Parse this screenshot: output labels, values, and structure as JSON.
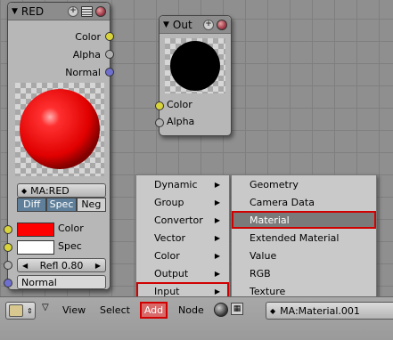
{
  "red_node": {
    "title": "RED",
    "outputs": [
      "Color",
      "Alpha",
      "Normal"
    ],
    "material": "MA:RED",
    "toggles": [
      "Diff",
      "Spec",
      "Neg"
    ],
    "inputs": {
      "color": "Color",
      "spec": "Spec",
      "refl": "Refl 0.80",
      "normal": "Normal"
    },
    "preview_color": "#ff1010",
    "color_swatch": "#ff0000",
    "spec_swatch": "#ffffff"
  },
  "out_node": {
    "title": "Out",
    "inputs": [
      "Color",
      "Alpha"
    ],
    "preview_color": "#000000"
  },
  "add_menu": {
    "items": [
      "Dynamic",
      "Group",
      "Convertor",
      "Vector",
      "Color",
      "Output",
      "Input"
    ],
    "active": "Input"
  },
  "input_submenu": {
    "items": [
      "Geometry",
      "Camera Data",
      "Material",
      "Extended Material",
      "Value",
      "RGB",
      "Texture"
    ],
    "highlighted": "Material"
  },
  "toolbar": {
    "view": "View",
    "select": "Select",
    "add": "Add",
    "node": "Node",
    "material_field": "MA:Material.001"
  }
}
